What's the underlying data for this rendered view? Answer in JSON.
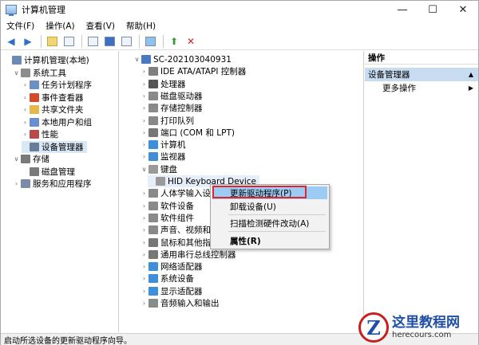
{
  "window": {
    "title": "计算机管理",
    "controls": {
      "minimize": "—",
      "maximize": "☐",
      "close": "✕"
    }
  },
  "menubar": [
    "文件(F)",
    "操作(A)",
    "查看(V)",
    "帮助(H)"
  ],
  "toolbar_icons": [
    "back-arrow-icon",
    "forward-arrow-icon",
    "up-folder-icon",
    "show-tree-icon",
    "properties-icon",
    "help-icon",
    "show-action-pane-icon",
    "monitor-icon",
    "enable-device-icon",
    "delete-icon"
  ],
  "left_tree": [
    {
      "label": "计算机管理(本地)",
      "arrow": "",
      "icon": "computer-management-icon",
      "color": "#6b8ab5",
      "indent": 0
    },
    {
      "label": "系统工具",
      "arrow": "∨",
      "icon": "tools-icon",
      "color": "#8d8d8d",
      "indent": 1
    },
    {
      "label": "任务计划程序",
      "arrow": "›",
      "icon": "task-scheduler-icon",
      "color": "#6c8fc4",
      "indent": 2
    },
    {
      "label": "事件查看器",
      "arrow": "›",
      "icon": "event-viewer-icon",
      "color": "#d14b2a",
      "indent": 2
    },
    {
      "label": "共享文件夹",
      "arrow": "›",
      "icon": "shared-folder-icon",
      "color": "#e6b84a",
      "indent": 2
    },
    {
      "label": "本地用户和组",
      "arrow": "›",
      "icon": "users-icon",
      "color": "#6a8fd0",
      "indent": 2
    },
    {
      "label": "性能",
      "arrow": "›",
      "icon": "performance-icon",
      "color": "#b94a4a",
      "indent": 2
    },
    {
      "label": "设备管理器",
      "arrow": "",
      "icon": "device-manager-icon",
      "color": "#6a7d96",
      "indent": 2,
      "selected": true
    },
    {
      "label": "存储",
      "arrow": "∨",
      "icon": "storage-icon",
      "color": "#7a7a7a",
      "indent": 1
    },
    {
      "label": "磁盘管理",
      "arrow": "",
      "icon": "disk-management-icon",
      "color": "#7a7a7a",
      "indent": 2
    },
    {
      "label": "服务和应用程序",
      "arrow": "›",
      "icon": "services-icon",
      "color": "#7a8aa8",
      "indent": 1
    }
  ],
  "device_tree": [
    {
      "label": "SC-202103040931",
      "arrow": "∨",
      "icon": "computer-icon",
      "color": "#4a79c4",
      "indent": 0
    },
    {
      "label": "IDE ATA/ATAPI 控制器",
      "arrow": "›",
      "icon": "ide-controller-icon",
      "color": "#7f7f7f",
      "indent": 1
    },
    {
      "label": "处理器",
      "arrow": "›",
      "icon": "processor-icon",
      "color": "#555",
      "indent": 1
    },
    {
      "label": "磁盘驱动器",
      "arrow": "›",
      "icon": "disk-drive-icon",
      "color": "#8a8a8a",
      "indent": 1
    },
    {
      "label": "存储控制器",
      "arrow": "›",
      "icon": "storage-controller-icon",
      "color": "#8a8a8a",
      "indent": 1
    },
    {
      "label": "打印队列",
      "arrow": "›",
      "icon": "printer-icon",
      "color": "#888",
      "indent": 1
    },
    {
      "label": "端口 (COM 和 LPT)",
      "arrow": "›",
      "icon": "port-icon",
      "color": "#777",
      "indent": 1
    },
    {
      "label": "计算机",
      "arrow": "›",
      "icon": "computer-icon",
      "color": "#3f8fd8",
      "indent": 1
    },
    {
      "label": "监视器",
      "arrow": "›",
      "icon": "monitor-icon",
      "color": "#3f8fd8",
      "indent": 1
    },
    {
      "label": "键盘",
      "arrow": "∨",
      "icon": "keyboard-icon",
      "color": "#999",
      "indent": 1
    },
    {
      "label": "HID Keyboard Device",
      "arrow": "",
      "icon": "keyboard-icon",
      "color": "#999",
      "indent": 2,
      "highlight": true
    },
    {
      "label": "人体学输入设备",
      "arrow": "›",
      "icon": "hid-icon",
      "color": "#8a8a8a",
      "indent": 1
    },
    {
      "label": "软件设备",
      "arrow": "›",
      "icon": "software-device-icon",
      "color": "#8a8a8a",
      "indent": 1
    },
    {
      "label": "软件组件",
      "arrow": "›",
      "icon": "software-component-icon",
      "color": "#8a8a8a",
      "indent": 1
    },
    {
      "label": "声音、视频和游戏控制器",
      "arrow": "›",
      "icon": "sound-icon",
      "color": "#8a8a8a",
      "indent": 1
    },
    {
      "label": "鼠标和其他指针设备",
      "arrow": "›",
      "icon": "mouse-icon",
      "color": "#777",
      "indent": 1
    },
    {
      "label": "通用串行总线控制器",
      "arrow": "›",
      "icon": "usb-icon",
      "color": "#777",
      "indent": 1
    },
    {
      "label": "网络适配器",
      "arrow": "›",
      "icon": "network-adapter-icon",
      "color": "#3f8fd8",
      "indent": 1
    },
    {
      "label": "系统设备",
      "arrow": "›",
      "icon": "system-device-icon",
      "color": "#3f8fd8",
      "indent": 1
    },
    {
      "label": "显示适配器",
      "arrow": "›",
      "icon": "display-adapter-icon",
      "color": "#3f8fd8",
      "indent": 1
    },
    {
      "label": "音频输入和输出",
      "arrow": "›",
      "icon": "audio-icon",
      "color": "#8a8a8a",
      "indent": 1
    }
  ],
  "context_menu": {
    "update_driver": "更新驱动程序(P)",
    "uninstall": "卸载设备(U)",
    "scan": "扫描检测硬件改动(A)",
    "properties": "属性(R)"
  },
  "actions": {
    "header": "操作",
    "section": "设备管理器",
    "more": "更多操作"
  },
  "status": "启动所选设备的更新驱动程序向导。",
  "watermark": {
    "logo": "Z",
    "name": "这里教程网",
    "url": "herecours.com"
  },
  "colors": {
    "accent_red": "#e0242b",
    "selection": "#9ecbf3"
  }
}
